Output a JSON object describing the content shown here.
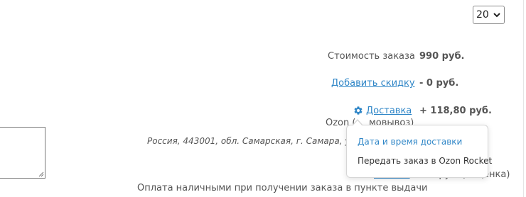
{
  "pager": {
    "per_page_value": "20"
  },
  "summary": {
    "order_cost_label": "Стоимость заказа",
    "order_cost_value": "990 руб.",
    "discount_link": "Добавить скидку",
    "discount_value": "- 0 руб.",
    "delivery_link": "Доставка",
    "delivery_value": "+ 118,80 руб.",
    "delivery_method_left": "Ozon (",
    "delivery_method_right": "мовывоз)",
    "address": "Россия, 443001, обл. Самарская, г. Самара, ул. ",
    "payment_link": "Оплата",
    "payment_value_tail": "+ 0 руб. (наценка)",
    "payment_method": "Оплата наличными при получении заказа в пункте выдачи"
  },
  "delivery_menu": {
    "items": [
      "Дата и время доставки",
      "Передать заказ в Ozon Rocket"
    ]
  },
  "colors": {
    "link": "#2f86c7",
    "text": "#555555"
  },
  "icons": {
    "delivery": "gear-icon",
    "select": "chevron-down-icon",
    "textarea": "resize-grip-icon"
  }
}
